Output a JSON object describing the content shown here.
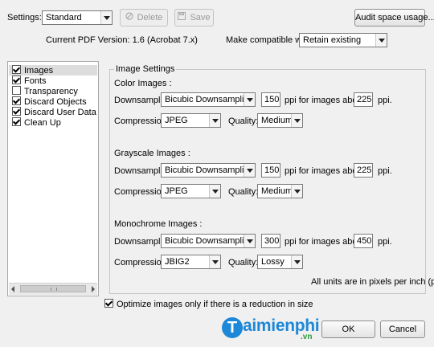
{
  "toolbar": {
    "settings_label": "Settings:",
    "settings_value": "Standard",
    "delete_label": "Delete",
    "save_label": "Save",
    "audit_label": "Audit space usage..."
  },
  "info": {
    "pdf_version": "Current PDF Version: 1.6 (Acrobat 7.x)",
    "compat_label": "Make compatible with:",
    "compat_value": "Retain existing"
  },
  "sidebar": {
    "items": [
      {
        "label": "Images",
        "checked": true,
        "selected": true
      },
      {
        "label": "Fonts",
        "checked": true,
        "selected": false
      },
      {
        "label": "Transparency",
        "checked": false,
        "selected": false
      },
      {
        "label": "Discard Objects",
        "checked": true,
        "selected": false
      },
      {
        "label": "Discard User Data",
        "checked": true,
        "selected": false
      },
      {
        "label": "Clean Up",
        "checked": true,
        "selected": false
      }
    ]
  },
  "image_settings": {
    "title": "Image Settings",
    "color": {
      "heading": "Color Images :",
      "downsample_label": "Downsample:",
      "downsample_value": "Bicubic Downsampling to",
      "ppi": "150",
      "ppi_above_label": "ppi for images above",
      "ppi_above": "225",
      "ppi_unit": "ppi.",
      "compression_label": "Compression:",
      "compression_value": "JPEG",
      "quality_label": "Quality:",
      "quality_value": "Medium"
    },
    "grayscale": {
      "heading": "Grayscale Images :",
      "downsample_label": "Downsample:",
      "downsample_value": "Bicubic Downsampling to",
      "ppi": "150",
      "ppi_above_label": "ppi for images above",
      "ppi_above": "225",
      "ppi_unit": "ppi.",
      "compression_label": "Compression:",
      "compression_value": "JPEG",
      "quality_label": "Quality:",
      "quality_value": "Medium"
    },
    "monochrome": {
      "heading": "Monochrome Images :",
      "downsample_label": "Downsample:",
      "downsample_value": "Bicubic Downsampling to",
      "ppi": "300",
      "ppi_above_label": "ppi for images above",
      "ppi_above": "450",
      "ppi_unit": "ppi.",
      "compression_label": "Compression:",
      "compression_value": "JBIG2",
      "quality_label": "Quality:",
      "quality_value": "Lossy"
    },
    "units_note": "All units are in pixels per inch (ppi)."
  },
  "optimize": {
    "label": "Optimize images only if there is a reduction in size",
    "checked": true
  },
  "footer": {
    "ok_label": "OK",
    "cancel_label": "Cancel"
  },
  "watermark": {
    "letter": "T",
    "text": "aimienphi",
    "suffix": ".vn"
  },
  "colors": {
    "watermark_blue": "#1e88d8",
    "watermark_green": "#2b9a3c",
    "selection": "#dcdcdc"
  }
}
